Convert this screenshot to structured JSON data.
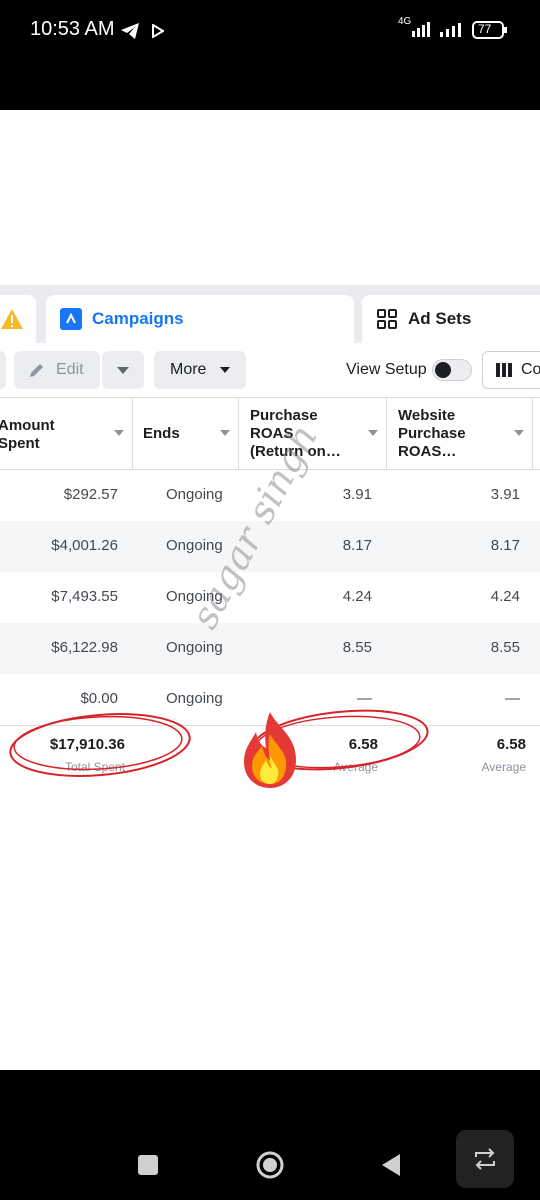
{
  "status_bar": {
    "time": "10:53 AM",
    "network": "4G",
    "battery": "77"
  },
  "tabs": [
    {
      "label": "Campaigns",
      "active": true
    },
    {
      "label": "Ad Sets",
      "active": false
    }
  ],
  "toolbar": {
    "edit_label": "Edit",
    "more_label": "More",
    "view_setup_label": "View Setup",
    "columns_label": "Co",
    "view_setup_on": false
  },
  "columns": [
    {
      "label": "Amount\nSpent"
    },
    {
      "label": "Ends"
    },
    {
      "label": "Purchase\nROAS\n(Return on…"
    },
    {
      "label": "Website\nPurchase\nROAS…"
    }
  ],
  "rows": [
    {
      "amount": "$292.57",
      "ends": "Ongoing",
      "roas": "3.91",
      "website_roas": "3.91"
    },
    {
      "amount": "$4,001.26",
      "ends": "Ongoing",
      "roas": "8.17",
      "website_roas": "8.17"
    },
    {
      "amount": "$7,493.55",
      "ends": "Ongoing",
      "roas": "4.24",
      "website_roas": "4.24"
    },
    {
      "amount": "$6,122.98",
      "ends": "Ongoing",
      "roas": "8.55",
      "website_roas": "8.55"
    },
    {
      "amount": "$0.00",
      "ends": "Ongoing",
      "roas": "—",
      "website_roas": "—"
    }
  ],
  "summary": {
    "amount": "$17,910.36",
    "amount_caption": "Total Spent",
    "roas": "6.58",
    "roas_caption": "Average",
    "website_roas": "6.58",
    "website_roas_caption": "Average"
  },
  "watermark": "sagar singh",
  "colors": {
    "accent": "#1877f2",
    "circle": "#d8232a",
    "warning": "#f7b928"
  }
}
